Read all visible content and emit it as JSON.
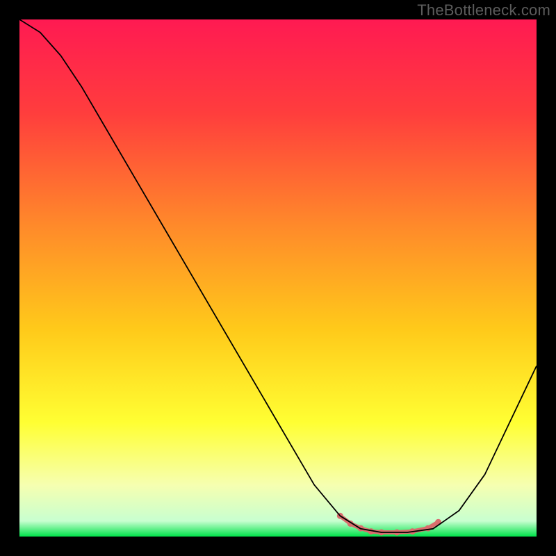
{
  "watermark": "TheBottleneck.com",
  "chart_data": {
    "type": "line",
    "title": "",
    "xlabel": "",
    "ylabel": "",
    "xlim": [
      0,
      100
    ],
    "ylim": [
      0,
      100
    ],
    "gradient_stops": [
      {
        "offset": 0.0,
        "color": "#ff1a52"
      },
      {
        "offset": 0.18,
        "color": "#ff3d3d"
      },
      {
        "offset": 0.4,
        "color": "#ff8a2a"
      },
      {
        "offset": 0.6,
        "color": "#ffca1a"
      },
      {
        "offset": 0.78,
        "color": "#ffff33"
      },
      {
        "offset": 0.9,
        "color": "#f6ffb0"
      },
      {
        "offset": 0.97,
        "color": "#c8ffd0"
      },
      {
        "offset": 1.0,
        "color": "#00e24a"
      }
    ],
    "series": [
      {
        "name": "bottleneck-curve",
        "stroke": "#000000",
        "stroke_width": 1.8,
        "data": [
          {
            "x": 0,
            "y": 100
          },
          {
            "x": 4,
            "y": 97.5
          },
          {
            "x": 8,
            "y": 93
          },
          {
            "x": 12,
            "y": 87
          },
          {
            "x": 57,
            "y": 10
          },
          {
            "x": 62,
            "y": 4
          },
          {
            "x": 66,
            "y": 1.5
          },
          {
            "x": 70,
            "y": 0.8
          },
          {
            "x": 75,
            "y": 0.8
          },
          {
            "x": 80,
            "y": 1.5
          },
          {
            "x": 85,
            "y": 5
          },
          {
            "x": 90,
            "y": 12
          },
          {
            "x": 100,
            "y": 33
          }
        ]
      },
      {
        "name": "sweet-spot-highlight",
        "stroke": "#d96d6d",
        "stroke_width": 6,
        "data": [
          {
            "x": 62,
            "y": 4
          },
          {
            "x": 64,
            "y": 2.5
          },
          {
            "x": 66,
            "y": 1.6
          },
          {
            "x": 68,
            "y": 1.0
          },
          {
            "x": 70,
            "y": 0.8
          },
          {
            "x": 73,
            "y": 0.8
          },
          {
            "x": 76,
            "y": 1.0
          },
          {
            "x": 79,
            "y": 1.6
          },
          {
            "x": 81,
            "y": 2.8
          }
        ]
      }
    ]
  }
}
